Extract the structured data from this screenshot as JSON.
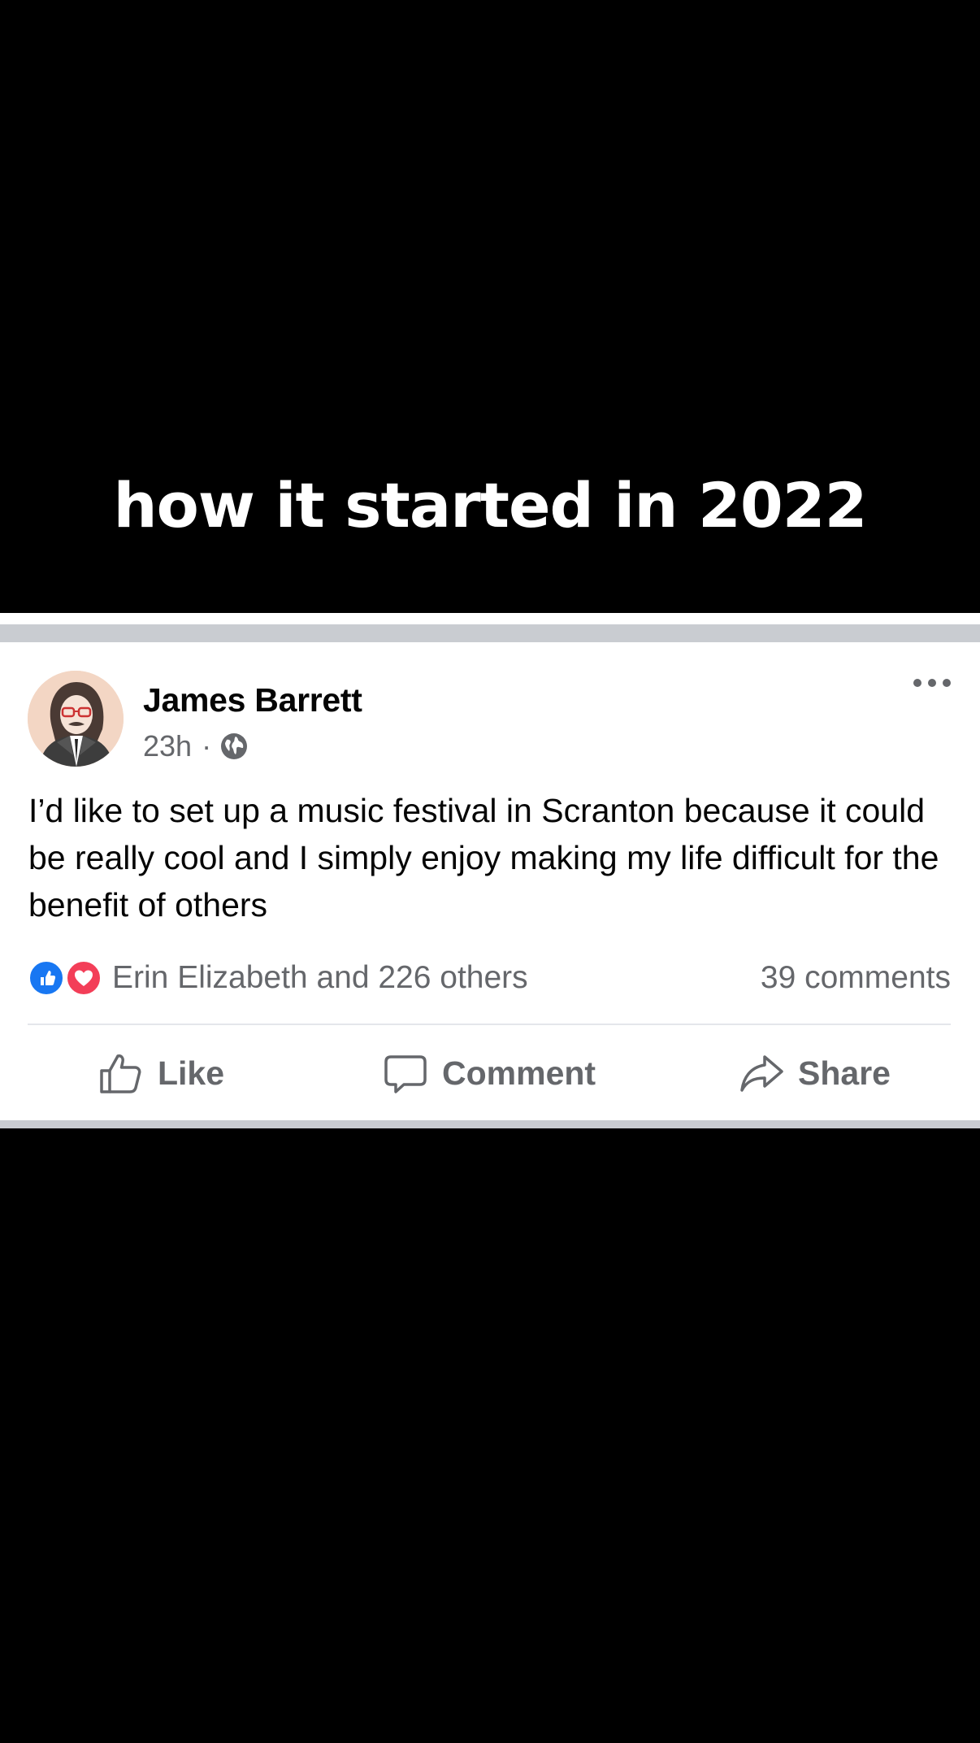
{
  "overlay": {
    "caption": "how it started in 2022"
  },
  "post": {
    "author": "James Barrett",
    "time": "23h",
    "separator": "·",
    "audience_icon": "globe-icon",
    "menu_icon": "more-horizontal-icon",
    "text": "I’d like to set up a music festival in Scranton because it could be really cool and I simply enjoy making my life difficult for the benefit of others",
    "reactions": {
      "icons": [
        "like-reaction-icon",
        "love-reaction-icon"
      ],
      "label": "Erin Elizabeth and 226 others"
    },
    "comments_label": "39 comments",
    "actions": {
      "like": "Like",
      "comment": "Comment",
      "share": "Share"
    }
  },
  "colors": {
    "background": "#000000",
    "card": "#ffffff",
    "separator_band": "#c9ccd1",
    "secondary_text": "#65676b",
    "primary_text": "#050505",
    "like_blue": "#1877f2",
    "love_red": "#f33e58"
  }
}
